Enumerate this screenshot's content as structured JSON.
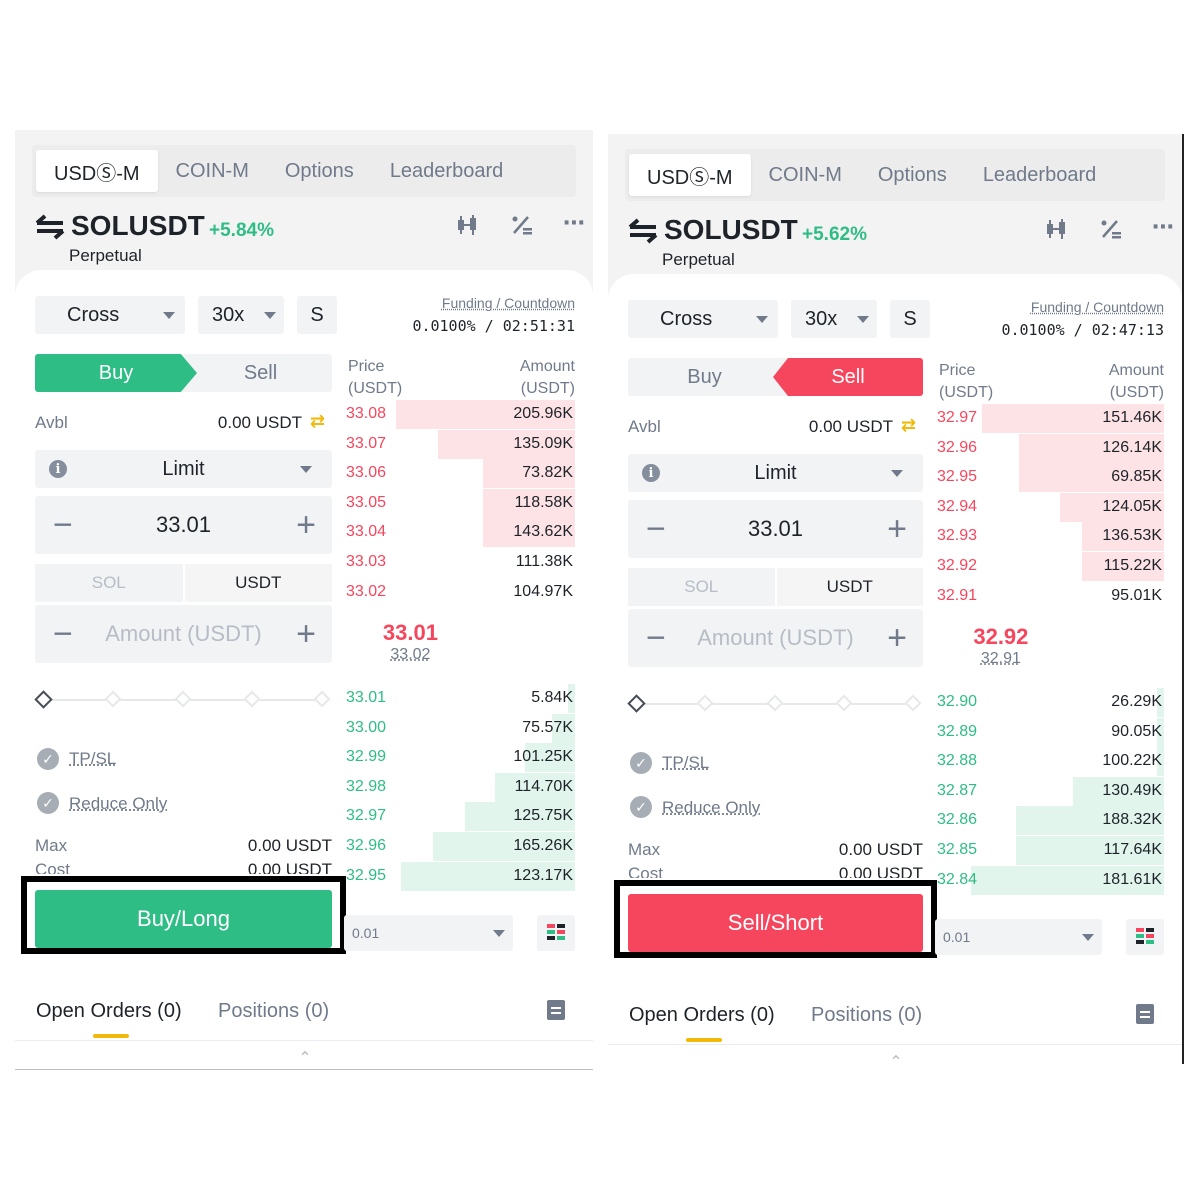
{
  "tabs": [
    "USDⓈ-M",
    "COIN-M",
    "Options",
    "Leaderboard"
  ],
  "header_icons": [
    "candlestick-chart-icon",
    "percent-calculator-icon",
    "more-icon"
  ],
  "colors": {
    "buy": "#2ebd85",
    "sell": "#f6465d",
    "accent": "#f0b90b",
    "muted": "#707a8a"
  },
  "common": {
    "perpetual": "Perpetual",
    "margin_mode": "Cross",
    "leverage": "30x",
    "asset_mode": "S",
    "funding_label": "Funding / Countdown",
    "buy_tab": "Buy",
    "sell_tab": "Sell",
    "avbl_label": "Avbl",
    "avbl_value": "0.00 USDT",
    "order_type": "Limit",
    "price_input": "33.01",
    "unit_sol": "SOL",
    "unit_usdt": "USDT",
    "amount_placeholder": "Amount (USDT)",
    "tpsl": "TP/SL",
    "reduce_only": "Reduce Only",
    "max_label": "Max",
    "max_value": "0.00 USDT",
    "cost_label": "Cost",
    "cost_value": "0.00 USDT",
    "ob_price_header": "Price",
    "ob_price_unit": "(USDT)",
    "ob_amount_header": "Amount",
    "ob_amount_unit": "(USDT)",
    "precision": "0.01",
    "open_orders": "Open Orders (0)",
    "positions": "Positions (0)",
    "leverage_slider_level": 0
  },
  "left": {
    "symbol": "SOLUSDT",
    "change": "+5.84%",
    "funding_value": "0.0100% / 02:51:31",
    "active_side": "buy",
    "action_label": "Buy/Long",
    "asks": [
      {
        "price": "33.08",
        "amount": "205.96K",
        "depth": 0.78
      },
      {
        "price": "33.07",
        "amount": "135.09K",
        "depth": 0.6
      },
      {
        "price": "33.06",
        "amount": "73.82K",
        "depth": 0.4
      },
      {
        "price": "33.05",
        "amount": "118.58K",
        "depth": 0.4
      },
      {
        "price": "33.04",
        "amount": "143.62K",
        "depth": 0.4
      },
      {
        "price": "33.03",
        "amount": "111.38K",
        "depth": 0.0
      },
      {
        "price": "33.02",
        "amount": "104.97K",
        "depth": 0.0
      }
    ],
    "last_price": "33.01",
    "mark_price": "33.02",
    "bids": [
      {
        "price": "33.01",
        "amount": "5.84K",
        "depth": 0.03
      },
      {
        "price": "33.00",
        "amount": "75.57K",
        "depth": 0.1
      },
      {
        "price": "32.99",
        "amount": "101.25K",
        "depth": 0.22
      },
      {
        "price": "32.98",
        "amount": "114.70K",
        "depth": 0.35
      },
      {
        "price": "32.97",
        "amount": "125.75K",
        "depth": 0.48
      },
      {
        "price": "32.96",
        "amount": "165.26K",
        "depth": 0.62
      },
      {
        "price": "32.95",
        "amount": "123.17K",
        "depth": 0.76
      }
    ]
  },
  "right": {
    "symbol": "SOLUSDT",
    "change": "+5.62%",
    "funding_value": "0.0100% / 02:47:13",
    "active_side": "sell",
    "action_label": "Sell/Short",
    "asks": [
      {
        "price": "32.97",
        "amount": "151.46K",
        "depth": 0.8
      },
      {
        "price": "32.96",
        "amount": "126.14K",
        "depth": 0.64
      },
      {
        "price": "32.95",
        "amount": "69.85K",
        "depth": 0.64
      },
      {
        "price": "32.94",
        "amount": "124.05K",
        "depth": 0.46
      },
      {
        "price": "32.93",
        "amount": "136.53K",
        "depth": 0.36
      },
      {
        "price": "32.92",
        "amount": "115.22K",
        "depth": 0.36
      },
      {
        "price": "32.91",
        "amount": "95.01K",
        "depth": 0.0
      }
    ],
    "last_price": "32.92",
    "mark_price": "32.91",
    "bids": [
      {
        "price": "32.90",
        "amount": "26.29K",
        "depth": 0.03
      },
      {
        "price": "32.89",
        "amount": "90.05K",
        "depth": 0.03
      },
      {
        "price": "32.88",
        "amount": "100.22K",
        "depth": 0.03
      },
      {
        "price": "32.87",
        "amount": "130.49K",
        "depth": 0.4
      },
      {
        "price": "32.86",
        "amount": "188.32K",
        "depth": 0.65
      },
      {
        "price": "32.85",
        "amount": "117.64K",
        "depth": 0.65
      },
      {
        "price": "32.84",
        "amount": "181.61K",
        "depth": 0.85
      }
    ]
  }
}
